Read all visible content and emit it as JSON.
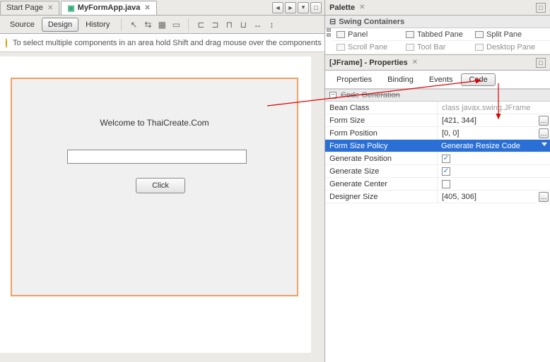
{
  "tabs": {
    "start": "Start Page",
    "file": "MyFormApp.java"
  },
  "modes": {
    "source": "Source",
    "design": "Design",
    "history": "History"
  },
  "hint": "To select multiple components in an area hold Shift and drag mouse over the components",
  "form": {
    "label": "Welcome to ThaiCreate.Com",
    "button": "Click"
  },
  "palette": {
    "title": "Palette",
    "section": "Swing Containers",
    "row1": {
      "a": "Panel",
      "b": "Tabbed Pane",
      "c": "Split Pane"
    },
    "row2": {
      "a": "Scroll Pane",
      "b": "Tool Bar",
      "c": "Desktop Pane"
    }
  },
  "properties": {
    "title": "[JFrame] - Properties",
    "tabs": {
      "properties": "Properties",
      "binding": "Binding",
      "events": "Events",
      "code": "Code"
    },
    "section": "Code Generation",
    "rows": {
      "bean_class": {
        "name": "Bean Class",
        "value": "class javax.swing.JFrame"
      },
      "form_size": {
        "name": "Form Size",
        "value": "[421, 344]"
      },
      "form_position": {
        "name": "Form Position",
        "value": "[0, 0]"
      },
      "form_size_policy": {
        "name": "Form Size Policy",
        "value": "Generate Resize Code"
      },
      "gen_position": {
        "name": "Generate Position"
      },
      "gen_size": {
        "name": "Generate Size"
      },
      "gen_center": {
        "name": "Generate Center"
      },
      "designer_size": {
        "name": "Designer Size",
        "value": "[405, 306]"
      }
    }
  }
}
